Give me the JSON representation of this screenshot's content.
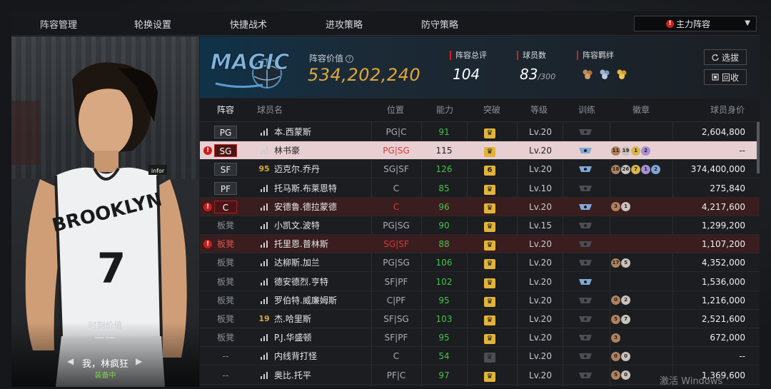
{
  "tabs": [
    {
      "label": "阵容管理",
      "active": true
    },
    {
      "label": "轮换设置",
      "active": false
    },
    {
      "label": "快捷战术",
      "active": false
    },
    {
      "label": "进攻策略",
      "active": false
    },
    {
      "label": "防守策略",
      "active": false
    }
  ],
  "lineup_select": {
    "label": "主力阵容",
    "warn": "!"
  },
  "portrait": {
    "jersey_team": "BROOKLYN",
    "jersey_number": "7",
    "jersey_sponsor": "infor",
    "moment_label": "时刻价值",
    "moment_value": "——",
    "name": "我，林疯狂",
    "status": "装备中"
  },
  "header": {
    "team_logo": "magic-logo",
    "value_label": "阵容价值",
    "value": "534,202,240",
    "rating_label": "阵容总评",
    "rating": "104",
    "count_label": "球员数",
    "count": "83",
    "count_max": "/300",
    "bond_label": "阵容羁绊",
    "btn_select": "选拔",
    "btn_recycle": "回收"
  },
  "columns": [
    "阵容",
    "球员名",
    "位置",
    "能力",
    "突破",
    "等级",
    "训练",
    "徽章",
    "球员身价"
  ],
  "rows": [
    {
      "slot": "PG",
      "ovr": "",
      "name": "本.西蒙斯",
      "role": "PG|C",
      "ability": "91",
      "breakthrough": "",
      "level": "Lv.20",
      "train": false,
      "badges": [],
      "value": "2,604,800",
      "state": ""
    },
    {
      "slot": "SG",
      "ovr": "",
      "name": "林书豪",
      "role": "PG|SG",
      "ability": "115",
      "breakthrough": "",
      "level": "Lv.20",
      "train": true,
      "badges": [
        "11",
        "19",
        "1",
        "2"
      ],
      "value": "--",
      "state": "sel"
    },
    {
      "slot": "SF",
      "ovr": "95",
      "name": "迈克尔.乔丹",
      "role": "SG|SF",
      "ability": "126",
      "breakthrough": "6",
      "level": "Lv.20",
      "train": true,
      "badges": [
        "18",
        "26",
        "7",
        "1",
        "2"
      ],
      "value": "374,400,000",
      "state": ""
    },
    {
      "slot": "PF",
      "ovr": "",
      "name": "托马斯.布莱恩特",
      "role": "C",
      "ability": "85",
      "breakthrough": "",
      "level": "Lv.10",
      "train": false,
      "badges": [],
      "value": "275,840",
      "state": ""
    },
    {
      "slot": "C",
      "ovr": "",
      "name": "安德鲁.德拉蒙德",
      "role": "C",
      "ability": "96",
      "breakthrough": "",
      "level": "Lv.20",
      "train": true,
      "badges": [
        "3",
        "1"
      ],
      "value": "4,217,600",
      "state": "warn"
    },
    {
      "slot": "板凳",
      "ovr": "",
      "name": "小凯文.波特",
      "role": "PG|SG",
      "ability": "90",
      "breakthrough": "",
      "level": "Lv.15",
      "train": false,
      "badges": [],
      "value": "1,299,200",
      "state": ""
    },
    {
      "slot": "板凳",
      "ovr": "",
      "name": "托里恩.普林斯",
      "role": "SG|SF",
      "ability": "88",
      "breakthrough": "",
      "level": "Lv.20",
      "train": false,
      "badges": [],
      "value": "1,107,200",
      "state": "warn"
    },
    {
      "slot": "板凳",
      "ovr": "",
      "name": "达柳斯.加兰",
      "role": "PG|SG",
      "ability": "106",
      "breakthrough": "",
      "level": "Lv.20",
      "train": false,
      "badges": [
        "17",
        "5"
      ],
      "value": "4,352,000",
      "state": ""
    },
    {
      "slot": "板凳",
      "ovr": "",
      "name": "德安德烈.亨特",
      "role": "SF|PF",
      "ability": "102",
      "breakthrough": "",
      "level": "Lv.20",
      "train": true,
      "badges": [],
      "value": "1,536,000",
      "state": ""
    },
    {
      "slot": "板凳",
      "ovr": "",
      "name": "罗伯特.威廉姆斯",
      "role": "C|PF",
      "ability": "95",
      "breakthrough": "",
      "level": "Lv.20",
      "train": false,
      "badges": [
        "0",
        "2"
      ],
      "value": "1,216,000",
      "state": ""
    },
    {
      "slot": "板凳",
      "ovr": "19",
      "name": "杰.哈里斯",
      "role": "SF|SG",
      "ability": "103",
      "breakthrough": "",
      "level": "Lv.20",
      "train": false,
      "badges": [
        "5",
        "7"
      ],
      "value": "2,521,600",
      "state": ""
    },
    {
      "slot": "板凳",
      "ovr": "",
      "name": "P.J.华盛顿",
      "role": "SF|PF",
      "ability": "95",
      "breakthrough": "",
      "level": "Lv.20",
      "train": false,
      "badges": [
        "3"
      ],
      "value": "672,000",
      "state": ""
    },
    {
      "slot": "--",
      "ovr": "",
      "name": "内线背打怪",
      "role": "C",
      "ability": "54",
      "breakthrough": "",
      "level": "Lv.20",
      "train": false,
      "badges": [
        "0",
        "0"
      ],
      "value": "--",
      "state": "ghost"
    },
    {
      "slot": "--",
      "ovr": "",
      "name": "奥比.托平",
      "role": "PF|C",
      "ability": "97",
      "breakthrough": "",
      "level": "Lv.20",
      "train": false,
      "badges": [
        "5",
        "0"
      ],
      "value": "1,369,600",
      "state": ""
    }
  ],
  "watermark": "激活 Windows",
  "colors": {
    "accent": "#e3b04b",
    "value_gold": "#e2a637",
    "warn": "#d3201f",
    "ability_green": "#48c24a"
  }
}
